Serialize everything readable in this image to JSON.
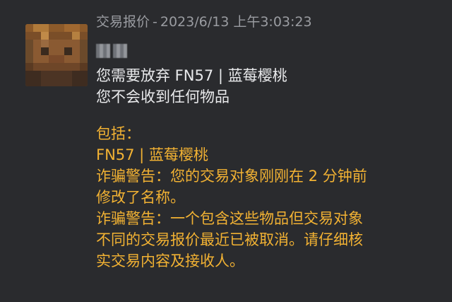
{
  "header": {
    "title": "交易报价",
    "separator": "-",
    "timestamp": "2023/6/13 上午3:03:23"
  },
  "sender": {
    "avatar_icon": "pixel-avatar-icon",
    "name_obscured": true
  },
  "message": {
    "give_line": "您需要放弃 FN57 | 蓝莓樱桃",
    "receive_line": "您不会收到任何物品",
    "includes_label": "包括：",
    "item": "FN57 | 蓝莓樱桃",
    "warning1_line1": "诈骗警告：您的交易对象刚刚在 2 分钟前",
    "warning1_line2": "修改了名称。",
    "warning2_line1": "诈骗警告：一个包含这些物品但交易对象",
    "warning2_line2": "不同的交易报价最近已被取消。请仔细核",
    "warning2_line3": "实交易内容及接收人。"
  },
  "colors": {
    "background": "#2a2b2e",
    "header_text": "#9a9ca1",
    "body_text": "#e9eaec",
    "warning_text": "#f2b233"
  }
}
